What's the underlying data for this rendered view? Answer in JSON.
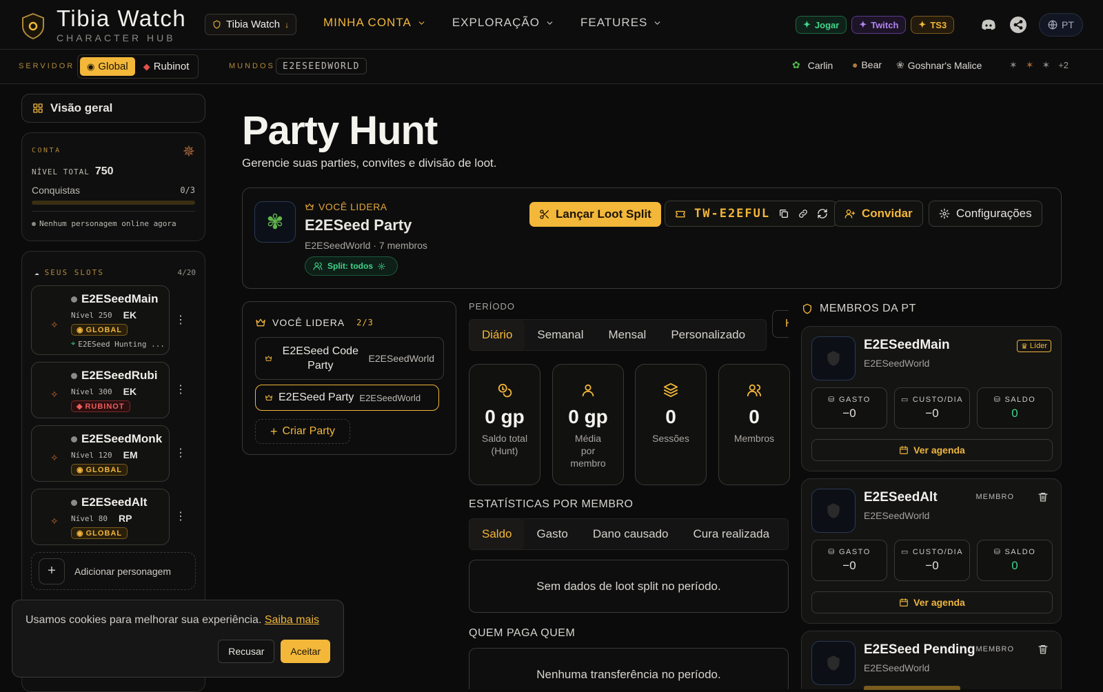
{
  "app": {
    "title": "Tibia Watch",
    "subtitle": "CHARACTER HUB",
    "workspace_label": "Tibia Watch"
  },
  "nav": [
    {
      "label": "MINHA CONTA",
      "active": true
    },
    {
      "label": "EXPLORAÇÃO",
      "active": false
    },
    {
      "label": "FEATURES",
      "active": false
    }
  ],
  "top_pills": {
    "play": "Jogar",
    "twitch": "Twitch",
    "ts3": "TS3"
  },
  "language": "PT",
  "subbar": {
    "server_label": "SERVIDOR",
    "servers": [
      {
        "label": "Global",
        "selected": true
      },
      {
        "label": "Rubinot",
        "selected": false
      }
    ],
    "worlds_label": "MUNDOS",
    "world": "E2ESEEDWORLD",
    "bosses": [
      "Carlin",
      "Bear",
      "Goshnar's Malice"
    ],
    "more": "+2"
  },
  "sidebar": {
    "overview": "Visão geral",
    "conta": {
      "label": "CONTA",
      "level_label": "NÍVEL TOTAL",
      "level": "750",
      "achievements_label": "Conquistas",
      "achievements": "0/3",
      "achievements_progress": 0,
      "online": "Nenhum personagem online agora"
    },
    "slots": {
      "label": "SEUS SLOTS",
      "count": "4/20",
      "items": [
        {
          "name": "E2ESeedMain",
          "level": "Nível 250",
          "voc": "EK",
          "server": "GLOBAL",
          "location": "E2ESeed Hunting ..."
        },
        {
          "name": "E2ESeedRubi",
          "level": "Nível 300",
          "voc": "EK",
          "server": "RUBINOT"
        },
        {
          "name": "E2ESeedMonk",
          "level": "Nível 120",
          "voc": "EM",
          "server": "GLOBAL"
        },
        {
          "name": "E2ESeedAlt",
          "level": "Nível 80",
          "voc": "RP",
          "server": "GLOBAL"
        }
      ],
      "add": "Adicionar personagem"
    }
  },
  "page": {
    "title": "Party Hunt",
    "subtitle": "Gerencie suas parties, convites e divisão de loot."
  },
  "party": {
    "role": "VOCÊ LIDERA",
    "name": "E2ESeed Party",
    "meta": "E2ESeedWorld · 7 membros",
    "split": "Split: todos",
    "launch": "Lançar Loot Split",
    "code": "TW-E2EFUL",
    "invite": "Convidar",
    "settings": "Configurações"
  },
  "party_list": {
    "label": "VOCÊ LIDERA",
    "count": "2/3",
    "items": [
      {
        "name": "E2ESeed Code Party",
        "world": "E2ESeedWorld",
        "selected": false
      },
      {
        "name": "E2ESeed Party",
        "world": "E2ESeedWorld",
        "selected": true
      }
    ],
    "create": "Criar Party"
  },
  "period": {
    "label": "PERÍODO",
    "tabs": [
      {
        "label": "Diário",
        "active": true
      },
      {
        "label": "Semanal"
      },
      {
        "label": "Mensal"
      },
      {
        "label": "Personalizado"
      }
    ],
    "overflow": "H"
  },
  "stats": [
    {
      "value": "0 gp",
      "label": "Saldo total (Hunt)"
    },
    {
      "value": "0 gp",
      "label": "Média por membro"
    },
    {
      "value": "0",
      "label": "Sessões"
    },
    {
      "value": "0",
      "label": "Membros"
    }
  ],
  "member_stats": {
    "title": "ESTATÍSTICAS POR MEMBRO",
    "tabs": [
      {
        "label": "Saldo",
        "active": true
      },
      {
        "label": "Gasto"
      },
      {
        "label": "Dano causado"
      },
      {
        "label": "Cura realizada"
      }
    ],
    "empty": "Sem dados de loot split no período."
  },
  "payments": {
    "title": "QUEM PAGA QUEM",
    "empty": "Nenhuma transferência no período."
  },
  "members": {
    "title": "MEMBROS DA PT",
    "stat_labels": {
      "spent": "GASTO",
      "cost": "CUSTO/DIA",
      "balance": "SALDO"
    },
    "agenda": "Ver agenda",
    "items": [
      {
        "name": "E2ESeedMain",
        "world": "E2ESeedWorld",
        "role": "Líder",
        "spent": "−0",
        "cost": "−0",
        "balance": "0"
      },
      {
        "name": "E2ESeedAlt",
        "world": "E2ESeedWorld",
        "role": "MEMBRO",
        "spent": "−0",
        "cost": "−0",
        "balance": "0"
      },
      {
        "name": "E2ESeed Pending",
        "world": "E2ESeedWorld",
        "role": "MEMBRO"
      }
    ]
  },
  "cookie": {
    "text": "Usamos cookies para melhorar sua experiência.",
    "link": "Saiba mais",
    "decline": "Recusar",
    "accept": "Aceitar"
  },
  "colors": {
    "accent": "#f3b73a",
    "positive": "#41d58a",
    "danger": "#f05b5b",
    "background": "#0b0b0c"
  },
  "icons": [
    "shield-logo-icon",
    "crown-icon",
    "scissors-icon",
    "ticket-icon",
    "copy-icon",
    "link-icon",
    "refresh-icon",
    "user-plus-icon",
    "gear-icon",
    "coins-icon",
    "user-icon",
    "layers-icon",
    "users-icon",
    "calendar-icon",
    "trash-icon",
    "discord-icon",
    "globe-icon",
    "grid-icon"
  ]
}
